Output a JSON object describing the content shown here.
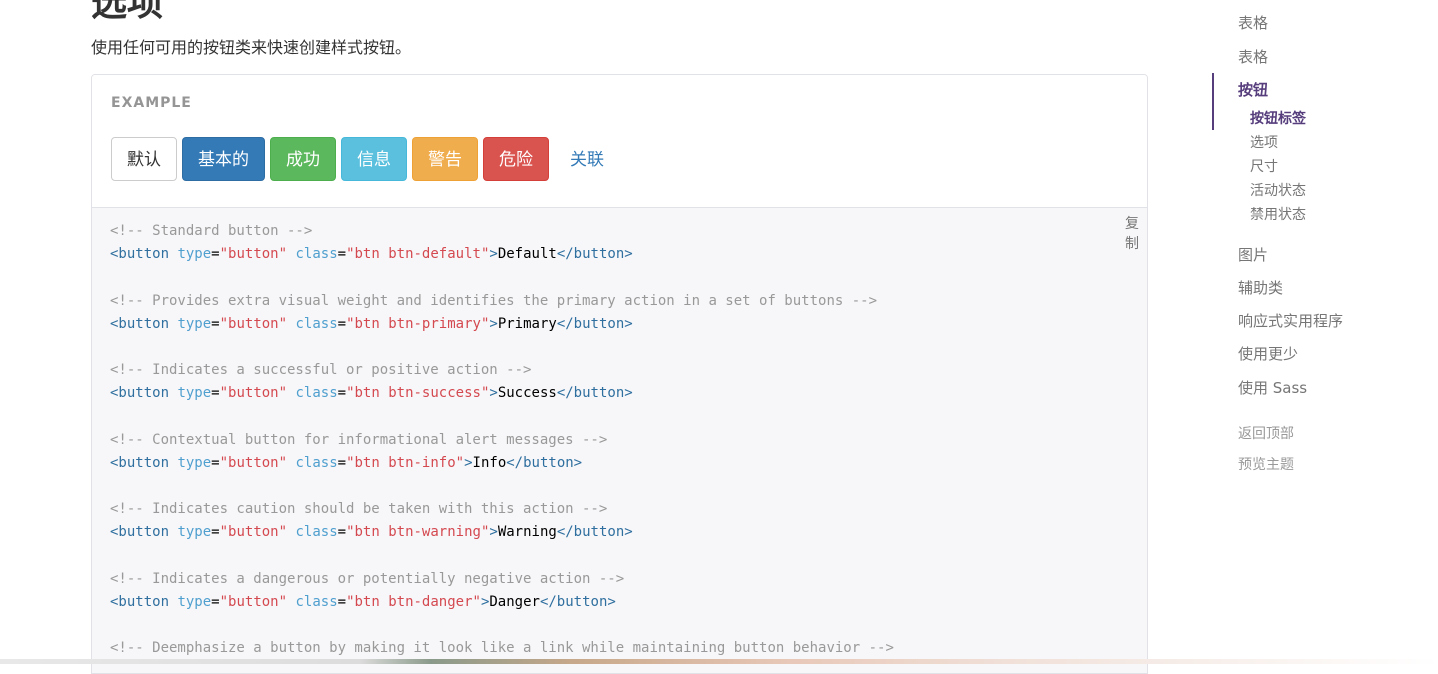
{
  "header": {
    "title": "选项",
    "lead": "使用任何可用的按钮类来快速创建样式按钮。"
  },
  "example": {
    "label": "EXAMPLE",
    "buttons": [
      {
        "label": "默认",
        "style": "default"
      },
      {
        "label": "基本的",
        "style": "primary"
      },
      {
        "label": "成功",
        "style": "success"
      },
      {
        "label": "信息",
        "style": "info"
      },
      {
        "label": "警告",
        "style": "warning"
      },
      {
        "label": "危险",
        "style": "danger"
      },
      {
        "label": "关联",
        "style": "link"
      }
    ]
  },
  "code": {
    "copy_label": "复制",
    "blocks": [
      {
        "comment": "<!-- Standard button -->",
        "cls": "btn btn-default",
        "text": "Default"
      },
      {
        "comment": "<!-- Provides extra visual weight and identifies the primary action in a set of buttons -->",
        "cls": "btn btn-primary",
        "text": "Primary"
      },
      {
        "comment": "<!-- Indicates a successful or positive action -->",
        "cls": "btn btn-success",
        "text": "Success"
      },
      {
        "comment": "<!-- Contextual button for informational alert messages -->",
        "cls": "btn btn-info",
        "text": "Info"
      },
      {
        "comment": "<!-- Indicates caution should be taken with this action -->",
        "cls": "btn btn-warning",
        "text": "Warning"
      },
      {
        "comment": "<!-- Indicates a dangerous or potentially negative action -->",
        "cls": "btn btn-danger",
        "text": "Danger"
      },
      {
        "comment": "<!-- Deemphasize a button by making it look like a link while maintaining button behavior -->"
      }
    ],
    "tag_open": "<button",
    "attr_type": "type",
    "attr_type_val": "\"button\"",
    "attr_class": "class",
    "tag_close": "</button>",
    "gt": ">",
    "eq": "="
  },
  "sidebar": {
    "items": [
      {
        "label": "表格"
      },
      {
        "label": "表格"
      },
      {
        "label": "按钮",
        "active": true
      },
      {
        "label": "图片"
      },
      {
        "label": "辅助类"
      },
      {
        "label": "响应式实用程序"
      },
      {
        "label": "使用更少"
      },
      {
        "label": "使用 Sass"
      }
    ],
    "subitems": [
      {
        "label": "按钮标签",
        "active": true
      },
      {
        "label": "选项"
      },
      {
        "label": "尺寸"
      },
      {
        "label": "活动状态"
      },
      {
        "label": "禁用状态"
      }
    ],
    "back_to_top": "返回顶部",
    "preview_theme": "预览主题"
  },
  "colors": {
    "primary": "#337ab7",
    "success": "#5cb85c",
    "info": "#5bc0de",
    "warning": "#f0ad4e",
    "danger": "#d9534f",
    "sidebar_active": "#563d7c",
    "code_background": "#f7f7f9"
  }
}
